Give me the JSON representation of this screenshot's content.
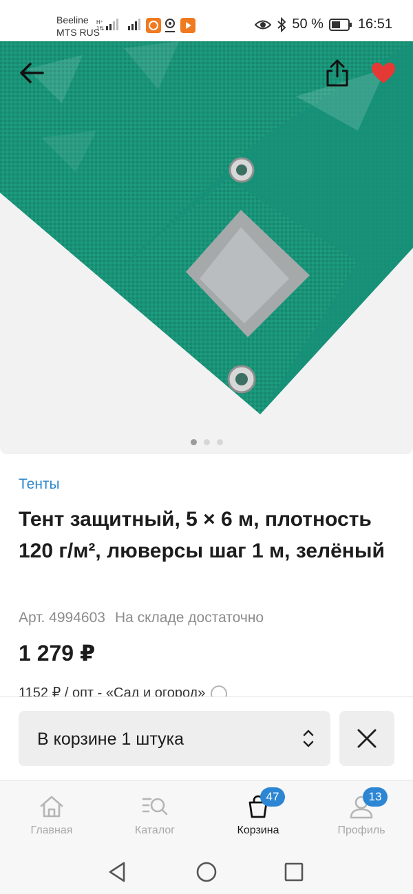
{
  "status_bar": {
    "carrier1": "Beeline",
    "carrier2": "MTS RUS",
    "battery_percent": "50 %",
    "time": "16:51"
  },
  "gallery": {
    "image_count": 3,
    "active_index": 0,
    "favorite_color": "#e53935"
  },
  "product": {
    "category": "Тенты",
    "title": "Тент защитный, 5 × 6 м, плотность 120 г/м², люверсы шаг 1 м, зелёный",
    "article": "Арт. 4994603",
    "stock": "На складе достаточно",
    "price": "1 279 ₽",
    "wholesale": "1152 ₽ / опт - «Сад и огород»"
  },
  "cart": {
    "quantity_label": "В корзине 1 штука"
  },
  "bottom_nav": {
    "items": [
      {
        "label": "Главная",
        "icon": "home-icon"
      },
      {
        "label": "Каталог",
        "icon": "catalog-search-icon"
      },
      {
        "label": "Корзина",
        "icon": "cart-bag-icon",
        "badge": "47",
        "active": true
      },
      {
        "label": "Профиль",
        "icon": "profile-icon",
        "badge": "13"
      }
    ]
  },
  "colors": {
    "accent": "#2d86d4",
    "category_link": "#2b87cc",
    "tarp_green": "#1a9478"
  }
}
